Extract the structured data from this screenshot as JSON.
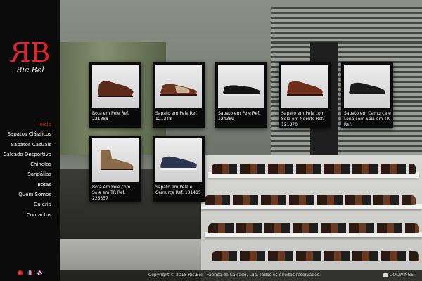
{
  "brand": {
    "mark_left": "R",
    "mark_right": "B",
    "sub": "Ric.Bel",
    "accent": "#e3242b"
  },
  "nav": {
    "items": [
      {
        "label": "Inicio",
        "active": true
      },
      {
        "label": "Sapatos Clássicos"
      },
      {
        "label": "Sapatos Casuais"
      },
      {
        "label": "Calçado Desportivo"
      },
      {
        "label": "Chinelos"
      },
      {
        "label": "Sandálias"
      },
      {
        "label": "Botas"
      },
      {
        "label": "Quem Somos"
      },
      {
        "label": "Galeria"
      },
      {
        "label": "Contactos"
      }
    ]
  },
  "languages": [
    "pt",
    "fr",
    "en"
  ],
  "products": [
    {
      "caption": "Bota em Pele Ref. 221388",
      "icon": "brown-leather-boot-icon"
    },
    {
      "caption": "Sapato em Pele Ref. 121348",
      "icon": "brown-two-tone-shoe-icon"
    },
    {
      "caption": "Sapato em Pele Ref. 124389",
      "icon": "black-loafer-icon"
    },
    {
      "caption": "Sapato em Pele com Sola em Neolite Ref. 121370",
      "icon": "brown-brogue-icon"
    },
    {
      "caption": "Sapato em Camurça e Lona com Sola em TR Ref.",
      "icon": "black-sneaker-icon"
    },
    {
      "caption": "Bota em Pele com Sola em TR Ref. 223357",
      "icon": "suede-boot-icon"
    },
    {
      "caption": "Sapato em Pele e Camurça Ref. 131415",
      "icon": "navy-sneaker-icon"
    }
  ],
  "footer": {
    "copyright": "Copyright © 2018 Ric.Bel - Fábrica de Calçado, Lda. Todos os direitos reservados.",
    "credit": "DOCWINGS"
  }
}
